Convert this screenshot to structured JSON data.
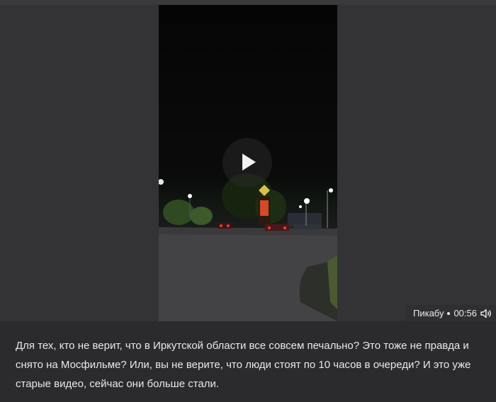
{
  "post": {
    "video": {
      "source": "Пикабу",
      "duration": "00:56",
      "play_icon": "play-icon",
      "sound_icon": "volume-icon"
    },
    "caption": "Для тех, кто не верит, что в Иркутской области все совсем печально? Это тоже не правда и снято на Мосфильме? Или, вы не верите, что люди стоят по 10 часов в очереди? И это уже старые видео, сейчас они больше стали."
  }
}
